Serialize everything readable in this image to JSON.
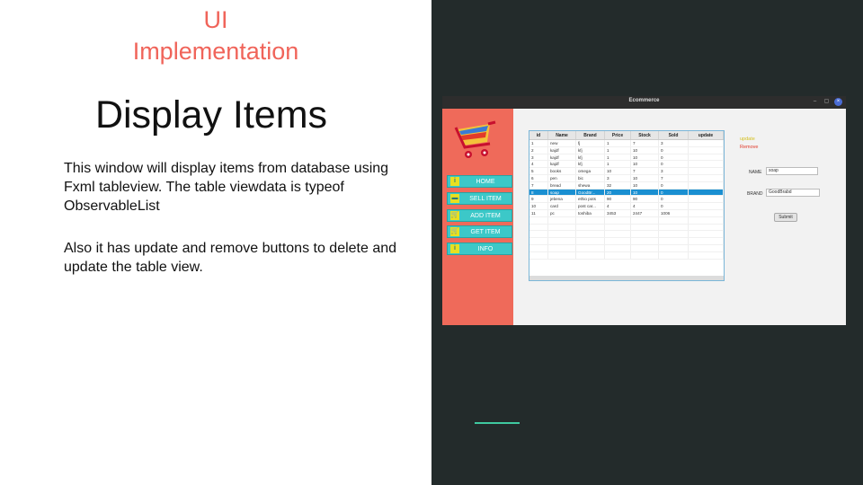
{
  "slide": {
    "kicker_line1": "UI",
    "kicker_line2": "Implementation",
    "heading": "Display Items",
    "paragraph1": "This window will display items from database using Fxml tableview. The table viewdata is typeof ObservableList",
    "paragraph2": "Also it has update and remove buttons to delete and update the table view."
  },
  "app": {
    "window_title": "Ecommerce",
    "window_controls": {
      "minimize": "–",
      "maximize": "▢",
      "close": "×"
    },
    "sidebar": [
      {
        "icon": "info-icon",
        "glyph": "i",
        "label": "HOME"
      },
      {
        "icon": "sell-icon",
        "glyph": "▬",
        "label": "SELL ITEM"
      },
      {
        "icon": "cart-icon",
        "glyph": "🛒",
        "label": "ADD ITEM"
      },
      {
        "icon": "cart-icon",
        "glyph": "🛒",
        "label": "GET ITEM"
      },
      {
        "icon": "info-icon",
        "glyph": "i",
        "label": "INFO"
      }
    ],
    "table": {
      "columns": [
        "id",
        "Name",
        "Brand",
        "Price",
        "Stock",
        "Sold",
        "update"
      ],
      "rows": [
        [
          "1",
          "new",
          "fj",
          "1",
          "7",
          "3",
          ""
        ],
        [
          "2",
          "kajdf",
          "kfj",
          "1",
          "10",
          "0",
          ""
        ],
        [
          "3",
          "kajdf",
          "kfj",
          "1",
          "10",
          "0",
          ""
        ],
        [
          "4",
          "kajdf",
          "kfj",
          "1",
          "10",
          "0",
          ""
        ],
        [
          "5",
          "books",
          "omega",
          "10",
          "7",
          "3",
          ""
        ],
        [
          "6",
          "pen",
          "bic",
          "3",
          "10",
          "7",
          ""
        ],
        [
          "7",
          "bread",
          "shewa",
          "32",
          "10",
          "0",
          ""
        ],
        [
          "8",
          "soap",
          "GoodBr...",
          "20",
          "10",
          "0",
          ""
        ],
        [
          "9",
          "jebena",
          "ethio pots",
          "90",
          "90",
          "0",
          ""
        ],
        [
          "10",
          "card",
          "post car...",
          "4",
          "4",
          "0",
          ""
        ],
        [
          "11",
          "pc",
          "toshiba",
          "3453",
          "2447",
          "1006",
          ""
        ]
      ],
      "selected_row_index": 7
    },
    "actions": {
      "update": "update",
      "remove": "Remove"
    },
    "form": {
      "name_label": "NAME",
      "name_value": "soap",
      "brand_label": "BRAND",
      "brand_value": "GoodBrabd",
      "submit": "Submit"
    }
  },
  "colors": {
    "accent_red": "#f0645a",
    "dark_panel": "#232b2b",
    "accent_green": "#3fc9a0",
    "sidebar_red": "#ef6a5a",
    "nav_teal": "#3cc8c8",
    "selection_blue": "#1a8fd1"
  }
}
